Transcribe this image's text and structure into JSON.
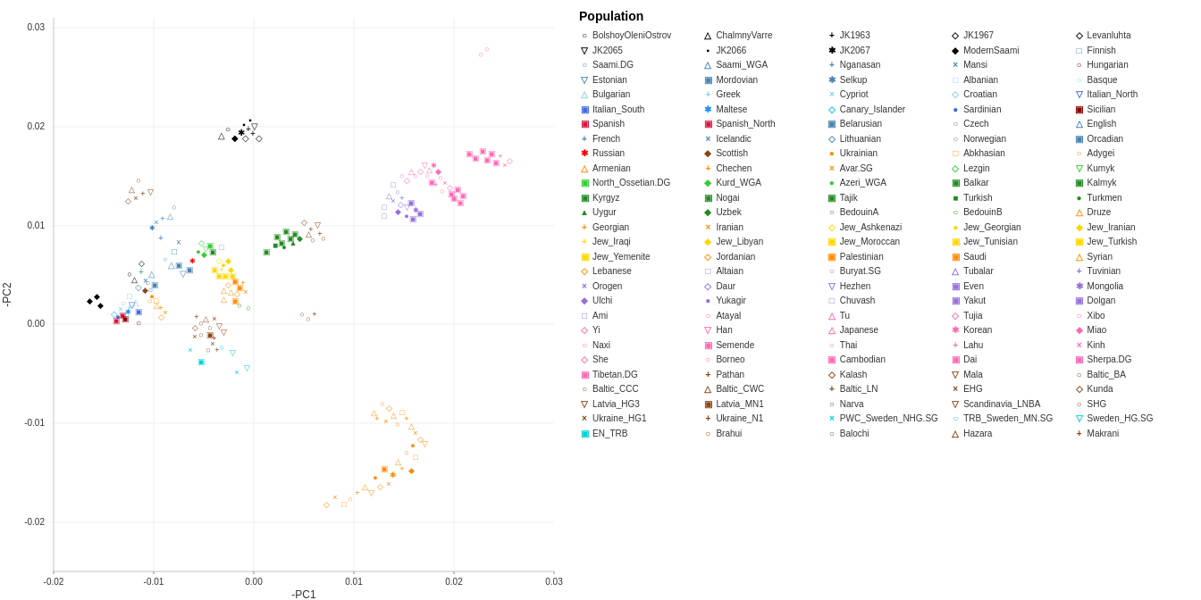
{
  "chart": {
    "title": "",
    "x_label": "-PC1",
    "y_label": "-PC2",
    "x_min": -0.02,
    "x_max": 0.03,
    "y_min": -0.025,
    "y_max": 0.031
  },
  "legend": {
    "title": "Population",
    "items": [
      {
        "symbol": "○",
        "color": "#000000",
        "label": "BolshoyOleniOstrov"
      },
      {
        "symbol": "△",
        "color": "#000000",
        "label": "ChalmnyVarre"
      },
      {
        "symbol": "+",
        "color": "#000000",
        "label": "JK1963"
      },
      {
        "symbol": "◇",
        "color": "#000000",
        "label": "JK1967"
      },
      {
        "symbol": "◇",
        "color": "#000000",
        "label": "Levanluhta"
      },
      {
        "symbol": "▽",
        "color": "#000000",
        "label": "JK2065"
      },
      {
        "symbol": "▪",
        "color": "#000000",
        "label": "JK2066"
      },
      {
        "symbol": "✱",
        "color": "#000000",
        "label": "JK2067"
      },
      {
        "symbol": "◆",
        "color": "#000000",
        "label": "ModernSaami"
      },
      {
        "symbol": "□",
        "color": "#4682B4",
        "label": "Finnish"
      },
      {
        "symbol": "○",
        "color": "#4682B4",
        "label": "Saami.DG"
      },
      {
        "symbol": "△",
        "color": "#4682B4",
        "label": "Saami_WGA"
      },
      {
        "symbol": "+",
        "color": "#4682B4",
        "label": "Nganasan"
      },
      {
        "symbol": "×",
        "color": "#4682B4",
        "label": "Mansi"
      },
      {
        "symbol": "○",
        "color": "#8B0000",
        "label": "Hungarian"
      },
      {
        "symbol": "▽",
        "color": "#4682B4",
        "label": "Estonian"
      },
      {
        "symbol": "▣",
        "color": "#4682B4",
        "label": "Mordovian"
      },
      {
        "symbol": "✱",
        "color": "#4682B4",
        "label": "Selkup"
      },
      {
        "symbol": "□",
        "color": "#87CEEB",
        "label": "Albanian"
      },
      {
        "symbol": "○",
        "color": "#87CEEB",
        "label": "Basque"
      },
      {
        "symbol": "△",
        "color": "#87CEEB",
        "label": "Bulgarian"
      },
      {
        "symbol": "+",
        "color": "#87CEEB",
        "label": "Greek"
      },
      {
        "symbol": "×",
        "color": "#87CEEB",
        "label": "Cypriot"
      },
      {
        "symbol": "◇",
        "color": "#87CEEB",
        "label": "Croatian"
      },
      {
        "symbol": "▽",
        "color": "#4169E1",
        "label": "Italian_North"
      },
      {
        "symbol": "▣",
        "color": "#4169E1",
        "label": "Italian_South"
      },
      {
        "symbol": "✱",
        "color": "#1E90FF",
        "label": "Maltese"
      },
      {
        "symbol": "◇",
        "color": "#00BFFF",
        "label": "Canary_Islander"
      },
      {
        "symbol": "●",
        "color": "#4169E1",
        "label": "Sardinian"
      },
      {
        "symbol": "▣",
        "color": "#8B0000",
        "label": "Sicilian"
      },
      {
        "symbol": "▣",
        "color": "#DC143C",
        "label": "Spanish"
      },
      {
        "symbol": "▣",
        "color": "#DC143C",
        "label": "Spanish_North"
      },
      {
        "symbol": "▣",
        "color": "#4682B4",
        "label": "Belarusian"
      },
      {
        "symbol": "○",
        "color": "#4682B4",
        "label": "Czech"
      },
      {
        "symbol": "△",
        "color": "#4682B4",
        "label": "English"
      },
      {
        "symbol": "+",
        "color": "#4682B4",
        "label": "French"
      },
      {
        "symbol": "×",
        "color": "#4682B4",
        "label": "Icelandic"
      },
      {
        "symbol": "◇",
        "color": "#4682B4",
        "label": "Lithuanian"
      },
      {
        "symbol": "○",
        "color": "#4682B4",
        "label": "Norwegian"
      },
      {
        "symbol": "▣",
        "color": "#4682B4",
        "label": "Orcadian"
      },
      {
        "symbol": "✱",
        "color": "#FF0000",
        "label": "Russian"
      },
      {
        "symbol": "◆",
        "color": "#8B4513",
        "label": "Scottish"
      },
      {
        "symbol": "●",
        "color": "#FF8C00",
        "label": "Ukrainian"
      },
      {
        "symbol": "□",
        "color": "#FF8C00",
        "label": "Abkhasian"
      },
      {
        "symbol": "○",
        "color": "#FF8C00",
        "label": "Adygei"
      },
      {
        "symbol": "△",
        "color": "#FF8C00",
        "label": "Armenian"
      },
      {
        "symbol": "+",
        "color": "#FF8C00",
        "label": "Chechen"
      },
      {
        "symbol": "×",
        "color": "#FF8C00",
        "label": "Avar.SG"
      },
      {
        "symbol": "◇",
        "color": "#32CD32",
        "label": "Lezgin"
      },
      {
        "symbol": "▽",
        "color": "#32CD32",
        "label": "Kumyk"
      },
      {
        "symbol": "▣",
        "color": "#32CD32",
        "label": "North_Ossetian.DG"
      },
      {
        "symbol": "◆",
        "color": "#32CD32",
        "label": "Kurd_WGA"
      },
      {
        "symbol": "●",
        "color": "#32CD32",
        "label": "Azeri_WGA"
      },
      {
        "symbol": "▣",
        "color": "#228B22",
        "label": "Balkar"
      },
      {
        "symbol": "▣",
        "color": "#228B22",
        "label": "Kalmyk"
      },
      {
        "symbol": "▣",
        "color": "#228B22",
        "label": "Kyrgyz"
      },
      {
        "symbol": "▣",
        "color": "#228B22",
        "label": "Nogai"
      },
      {
        "symbol": "▣",
        "color": "#228B22",
        "label": "Tajik"
      },
      {
        "symbol": "■",
        "color": "#228B22",
        "label": "Turkish"
      },
      {
        "symbol": "●",
        "color": "#228B22",
        "label": "Turkmen"
      },
      {
        "symbol": "▲",
        "color": "#228B22",
        "label": "Uygur"
      },
      {
        "symbol": "◆",
        "color": "#228B22",
        "label": "Uzbek"
      },
      {
        "symbol": "○",
        "color": "#228B22",
        "label": "BedouinA"
      },
      {
        "symbol": "○",
        "color": "#228B22",
        "label": "BedouinB"
      },
      {
        "symbol": "△",
        "color": "#FF8C00",
        "label": "Druze"
      },
      {
        "symbol": "+",
        "color": "#FF8C00",
        "label": "Georgian"
      },
      {
        "symbol": "×",
        "color": "#FF8C00",
        "label": "Iranian"
      },
      {
        "symbol": "◇",
        "color": "#FFD700",
        "label": "Jew_Ashkenazi"
      },
      {
        "symbol": "●",
        "color": "#FFD700",
        "label": "Jew_Georgian"
      },
      {
        "symbol": "◆",
        "color": "#FFD700",
        "label": "Jew_Iranian"
      },
      {
        "symbol": "+",
        "color": "#FFD700",
        "label": "Jew_Iraqi"
      },
      {
        "symbol": "◆",
        "color": "#FFD700",
        "label": "Jew_Libyan"
      },
      {
        "symbol": "▣",
        "color": "#FFD700",
        "label": "Jew_Moroccan"
      },
      {
        "symbol": "▣",
        "color": "#FFD700",
        "label": "Jew_Tunisian"
      },
      {
        "symbol": "▣",
        "color": "#FFD700",
        "label": "Jew_Turkish"
      },
      {
        "symbol": "▣",
        "color": "#FFD700",
        "label": "Jew_Yemenite"
      },
      {
        "symbol": "◇",
        "color": "#FF8C00",
        "label": "Jordanian"
      },
      {
        "symbol": "▣",
        "color": "#FF8C00",
        "label": "Palestinian"
      },
      {
        "symbol": "▣",
        "color": "#FF8C00",
        "label": "Saudi"
      },
      {
        "symbol": "△",
        "color": "#FF8C00",
        "label": "Syrian"
      },
      {
        "symbol": "◇",
        "color": "#FF8C00",
        "label": "Lebanese"
      },
      {
        "symbol": "□",
        "color": "#9370DB",
        "label": "Altaian"
      },
      {
        "symbol": "○",
        "color": "#9370DB",
        "label": "Buryat.SG"
      },
      {
        "symbol": "△",
        "color": "#9370DB",
        "label": "Tubalar"
      },
      {
        "symbol": "+",
        "color": "#9370DB",
        "label": "Tuvinian"
      },
      {
        "symbol": "×",
        "color": "#9370DB",
        "label": "Orogen"
      },
      {
        "symbol": "◇",
        "color": "#9370DB",
        "label": "Daur"
      },
      {
        "symbol": "▽",
        "color": "#9370DB",
        "label": "Hezhen"
      },
      {
        "symbol": "▣",
        "color": "#9370DB",
        "label": "Even"
      },
      {
        "symbol": "✱",
        "color": "#9370DB",
        "label": "Mongolia"
      },
      {
        "symbol": "◆",
        "color": "#9370DB",
        "label": "Ulchi"
      },
      {
        "symbol": "●",
        "color": "#9370DB",
        "label": "Yukagir"
      },
      {
        "symbol": "□",
        "color": "#9370DB",
        "label": "Chuvash"
      },
      {
        "symbol": "▣",
        "color": "#9370DB",
        "label": "Yakut"
      },
      {
        "symbol": "▣",
        "color": "#9370DB",
        "label": "Dolgan"
      },
      {
        "symbol": "□",
        "color": "#9370DB",
        "label": "Ami"
      },
      {
        "symbol": "○",
        "color": "#FF69B4",
        "label": "Atayal"
      },
      {
        "symbol": "△",
        "color": "#FF69B4",
        "label": "Tu"
      },
      {
        "symbol": "◇",
        "color": "#FF69B4",
        "label": "Tujia"
      },
      {
        "symbol": "○",
        "color": "#FF69B4",
        "label": "Xibo"
      },
      {
        "symbol": "◇",
        "color": "#FF69B4",
        "label": "Yi"
      },
      {
        "symbol": "▽",
        "color": "#FF69B4",
        "label": "Han"
      },
      {
        "symbol": "△",
        "color": "#FF69B4",
        "label": "Japanese"
      },
      {
        "symbol": "✱",
        "color": "#FF69B4",
        "label": "Korean"
      },
      {
        "symbol": "◆",
        "color": "#FF69B4",
        "label": "Miao"
      },
      {
        "symbol": "○",
        "color": "#FF69B4",
        "label": "Naxi"
      },
      {
        "symbol": "▣",
        "color": "#FF69B4",
        "label": "Semende"
      },
      {
        "symbol": "○",
        "color": "#FF69B4",
        "label": "Thai"
      },
      {
        "symbol": "+",
        "color": "#FF69B4",
        "label": "Lahu"
      },
      {
        "symbol": "×",
        "color": "#FF69B4",
        "label": "Kinh"
      },
      {
        "symbol": "◇",
        "color": "#FF69B4",
        "label": "She"
      },
      {
        "symbol": "○",
        "color": "#FF69B4",
        "label": "Borneo"
      },
      {
        "symbol": "▣",
        "color": "#FF69B4",
        "label": "Cambodian"
      },
      {
        "symbol": "▣",
        "color": "#FF69B4",
        "label": "Dai"
      },
      {
        "symbol": "▣",
        "color": "#FF69B4",
        "label": "Sherpa.DG"
      },
      {
        "symbol": "▣",
        "color": "#FF69B4",
        "label": "Tibetan.DG"
      },
      {
        "symbol": "+",
        "color": "#8B4513",
        "label": "Pathan"
      },
      {
        "symbol": "◇",
        "color": "#8B4513",
        "label": "Kalash"
      },
      {
        "symbol": "▽",
        "color": "#8B4513",
        "label": "Mala"
      },
      {
        "symbol": "○",
        "color": "#8B4513",
        "label": "Baltic_BA"
      },
      {
        "symbol": "○",
        "color": "#8B4513",
        "label": "Baltic_CCC"
      },
      {
        "symbol": "△",
        "color": "#8B4513",
        "label": "Baltic_CWC"
      },
      {
        "symbol": "+",
        "color": "#8B4513",
        "label": "Baltic_LN"
      },
      {
        "symbol": "×",
        "color": "#8B4513",
        "label": "EHG"
      },
      {
        "symbol": "◇",
        "color": "#8B4513",
        "label": "Kunda"
      },
      {
        "symbol": "▽",
        "color": "#8B4513",
        "label": "Latvia_HG3"
      },
      {
        "symbol": "▣",
        "color": "#8B4513",
        "label": "Latvia_MN1"
      },
      {
        "symbol": "○",
        "color": "#8B4513",
        "label": "Narva"
      },
      {
        "symbol": "▽",
        "color": "#8B4513",
        "label": "Scandinavia_LNBA"
      },
      {
        "symbol": "○",
        "color": "#8B4513",
        "label": "SHG"
      },
      {
        "symbol": "×",
        "color": "#8B4513",
        "label": "Ukraine_HG1"
      },
      {
        "symbol": "+",
        "color": "#8B4513",
        "label": "Ukraine_N1"
      },
      {
        "symbol": "×",
        "color": "#00CED1",
        "label": "PWC_Sweden_NHG.SG"
      },
      {
        "symbol": "○",
        "color": "#00CED1",
        "label": "TRB_Sweden_MN.SG"
      },
      {
        "symbol": "▽",
        "color": "#00CED1",
        "label": "Sweden_HG.SG"
      },
      {
        "symbol": "▣",
        "color": "#00CED1",
        "label": "EN_TRB"
      },
      {
        "symbol": "○",
        "color": "#8B4513",
        "label": "Brahui"
      },
      {
        "symbol": "○",
        "color": "#8B4513",
        "label": "Balochi"
      },
      {
        "symbol": "△",
        "color": "#8B4513",
        "label": "Hazara"
      },
      {
        "symbol": "+",
        "color": "#8B4513",
        "label": "Makrani"
      }
    ]
  }
}
